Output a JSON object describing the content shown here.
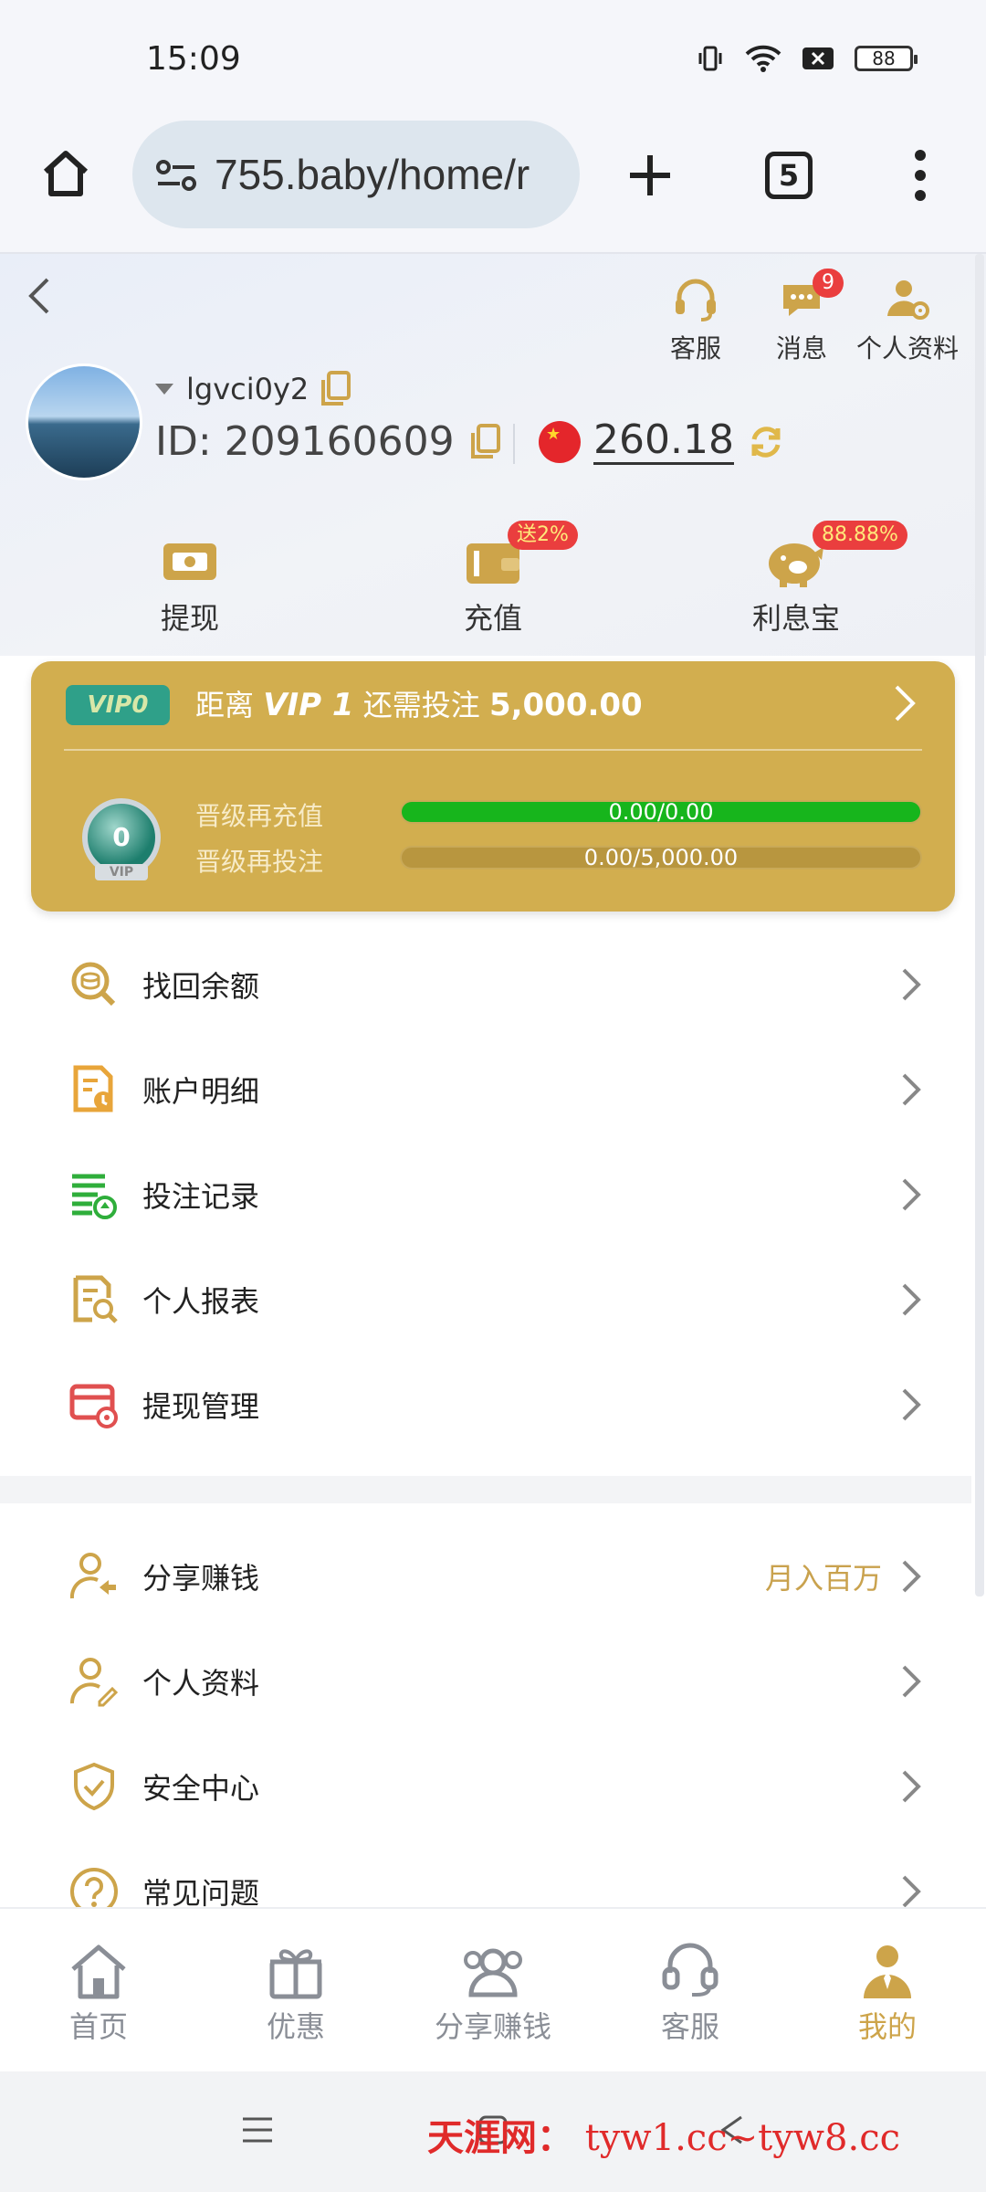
{
  "status_bar": {
    "time": "15:09",
    "battery": "88",
    "icons": [
      "vibrate-icon",
      "wifi-icon",
      "sim-off-icon",
      "battery-icon"
    ]
  },
  "browser": {
    "url": "755.baby/home/r",
    "tab_count": "5"
  },
  "header": {
    "top_actions": [
      {
        "label": "客服",
        "icon": "headset-icon"
      },
      {
        "label": "消息",
        "icon": "message-icon",
        "badge": "9"
      },
      {
        "label": "个人资料",
        "icon": "user-settings-icon"
      }
    ],
    "username": "lgvci0y2",
    "id_label": "ID: 209160609",
    "balance": "260.18",
    "quick_actions": [
      {
        "label": "提现",
        "icon": "withdraw-icon"
      },
      {
        "label": "充值",
        "icon": "wallet-icon",
        "badge": "送2%"
      },
      {
        "label": "利息宝",
        "icon": "piggy-bank-icon",
        "badge": "88.88%"
      }
    ]
  },
  "vip": {
    "chip": "VIP0",
    "text_prefix": "距离",
    "next_level": "VIP 1",
    "text_mid": "还需投注",
    "required": "5,000.00",
    "level": "0",
    "rows": [
      {
        "label": "晋级再充值",
        "value": "0.00/0.00",
        "progress": 1.0
      },
      {
        "label": "晋级再投注",
        "value": "0.00/5,000.00",
        "progress": 0.0
      }
    ]
  },
  "menu_group1": [
    {
      "label": "找回余额",
      "icon": "coin-search-icon"
    },
    {
      "label": "账户明细",
      "icon": "account-detail-icon"
    },
    {
      "label": "投注记录",
      "icon": "bet-record-icon"
    },
    {
      "label": "个人报表",
      "icon": "report-icon"
    },
    {
      "label": "提现管理",
      "icon": "withdraw-manage-icon"
    }
  ],
  "menu_group2": [
    {
      "label": "分享赚钱",
      "icon": "share-earn-icon",
      "right_text": "月入百万"
    },
    {
      "label": "个人资料",
      "icon": "profile-edit-icon"
    },
    {
      "label": "安全中心",
      "icon": "shield-icon"
    },
    {
      "label": "常见问题",
      "icon": "question-icon"
    }
  ],
  "tabbar": [
    {
      "label": "首页",
      "icon": "home-icon"
    },
    {
      "label": "优惠",
      "icon": "gift-icon"
    },
    {
      "label": "分享赚钱",
      "icon": "share-people-icon"
    },
    {
      "label": "客服",
      "icon": "headset-icon"
    },
    {
      "label": "我的",
      "icon": "person-icon",
      "active": true
    }
  ],
  "watermark": {
    "brand": "天涯网：",
    "domains": "tyw1.cc~tyw8.cc"
  },
  "colors": {
    "gold": "#d2ae4f",
    "accent": "#cda44a",
    "green_bar": "#17b51c",
    "badge_red": "#ea3e3e"
  }
}
